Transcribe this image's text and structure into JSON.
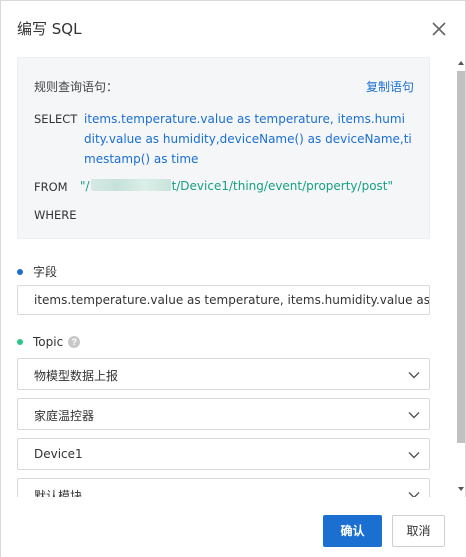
{
  "dialog": {
    "title": "编写 SQL"
  },
  "sql": {
    "label": "规则查询语句：",
    "copy_label": "复制语句",
    "select_kw": "SELECT",
    "fields": "items.temperature.value as temperature, items.humidity.value as humidity,deviceName() as deviceName,timestamp() as time",
    "from_kw": "FROM",
    "topic_prefix": "\"/",
    "topic_suffix": "t/Device1/thing/event/property/post\"",
    "where_kw": "WHERE"
  },
  "fields_section": {
    "label": "字段",
    "value": "items.temperature.value as temperature, items.humidity.value as humidi"
  },
  "topic_section": {
    "label": "Topic",
    "help_icon": "?",
    "selects": [
      {
        "value": "物模型数据上报"
      },
      {
        "value": "家庭温控器"
      },
      {
        "value": "Device1"
      },
      {
        "value": "默认模块"
      }
    ]
  },
  "footer": {
    "ok_label": "确认",
    "cancel_label": "取消"
  },
  "colors": {
    "accent": "#1a6fd1",
    "topic_green": "#16a085",
    "dot_green": "#2bc48a"
  }
}
